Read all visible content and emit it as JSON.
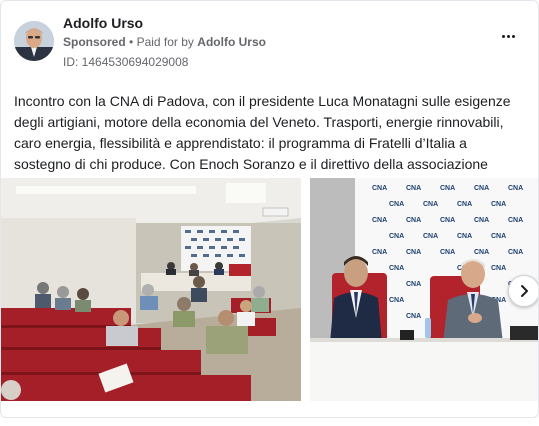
{
  "post": {
    "author": "Adolfo Urso",
    "sponsored_label": "Sponsored",
    "separator": "•",
    "paid_for_prefix": "Paid for by",
    "paid_for_name": "Adolfo Urso",
    "ad_id": "ID: 1464530694029008",
    "text": "Incontro con la CNA di Padova, con il presidente Luca Monatagni sulle esigenze degli artigiani, motore della economia del Veneto. Trasporti, energie rinnovabili, caro energia, flessibilità e apprendistato: il programma di Fratelli d’Italia a sostegno di chi produce. Con Enoch Soranzo e il direttivo della associazione"
  },
  "backdrop_logo_text": "CNA",
  "icons": {
    "more": "more-options-icon",
    "next": "chevron-right-icon"
  },
  "colors": {
    "text": "#1c1e21",
    "secondary_text": "#65676b",
    "chair_red": "#b3232b",
    "cna_blue": "#1c3f6e"
  }
}
